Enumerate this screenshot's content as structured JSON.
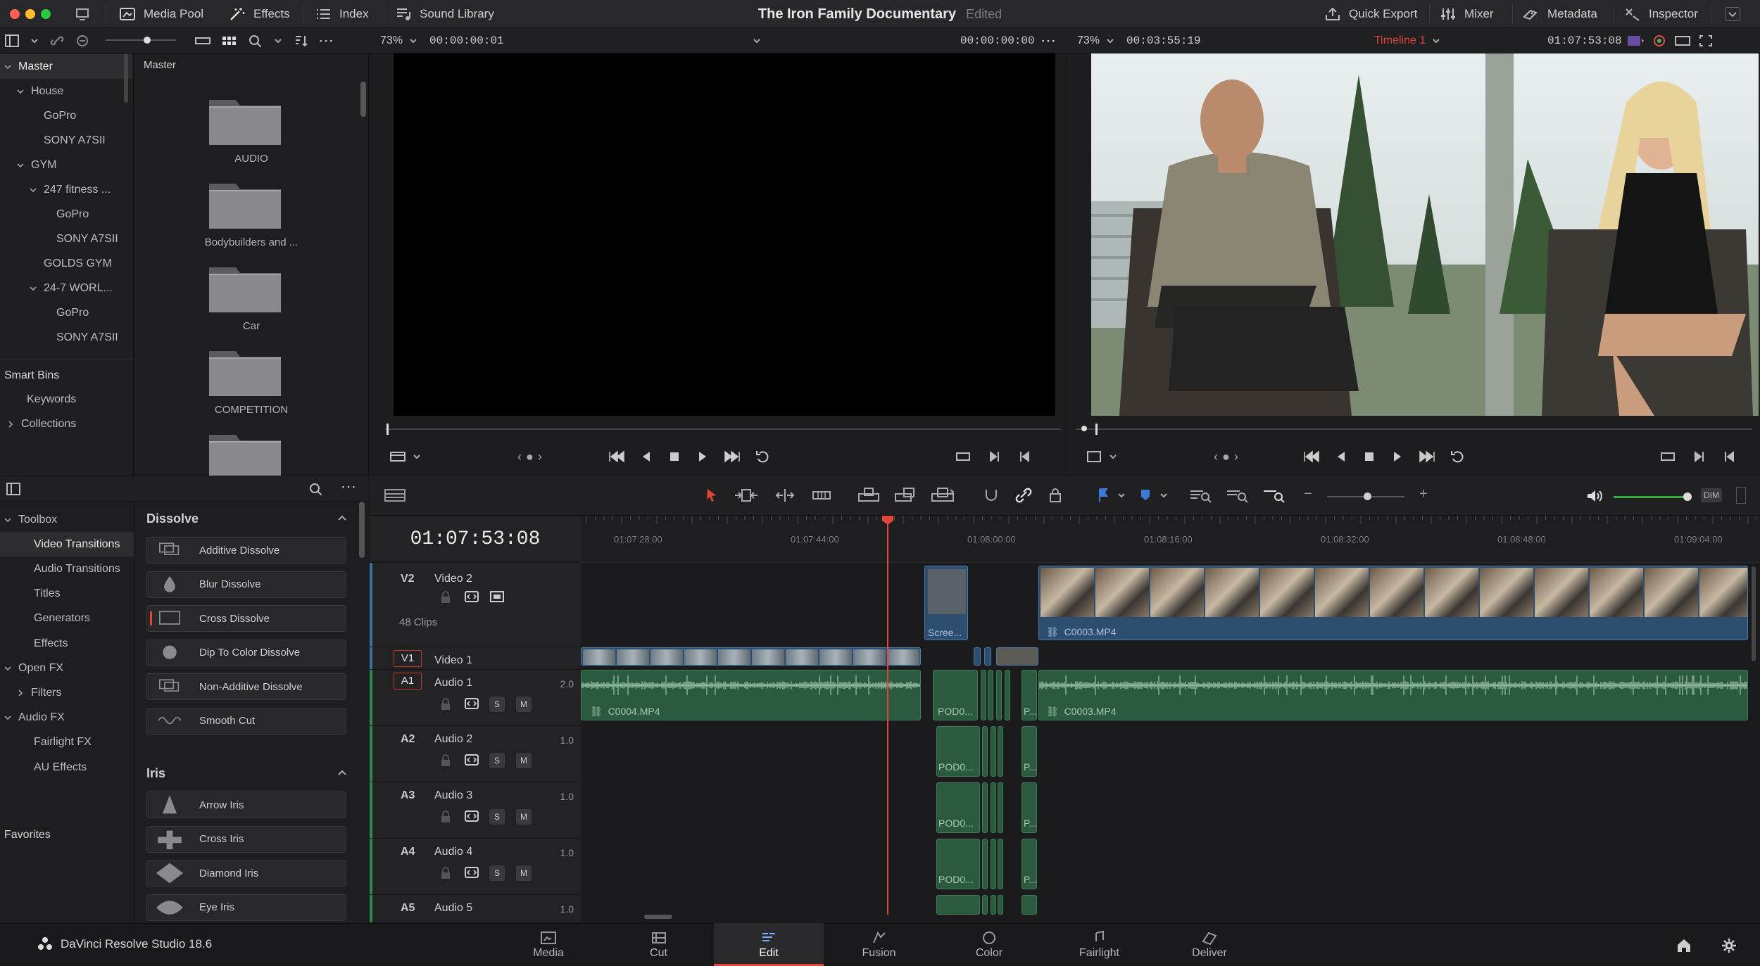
{
  "colors": {
    "accent_red": "#e0443a",
    "audio_green": "#2b5a3f",
    "video_blue": "#2e4e6f",
    "playhead": "#e0443a"
  },
  "topbar": {
    "title": "The Iron Family Documentary",
    "status": "Edited",
    "left": [
      {
        "label": "Media Pool",
        "icon": "media-pool-icon"
      },
      {
        "label": "Effects",
        "icon": "effects-wand-icon"
      },
      {
        "label": "Index",
        "icon": "index-list-icon"
      },
      {
        "label": "Sound Library",
        "icon": "sound-library-icon"
      }
    ],
    "right": [
      {
        "label": "Quick Export",
        "icon": "export-icon"
      },
      {
        "label": "Mixer",
        "icon": "mixer-icon"
      },
      {
        "label": "Metadata",
        "icon": "metadata-icon"
      },
      {
        "label": "Inspector",
        "icon": "inspector-icon"
      }
    ]
  },
  "source_viewer": {
    "zoom": "73%",
    "timecode_left": "00:00:00:01",
    "timecode_right": "00:00:00:00"
  },
  "timeline_viewer": {
    "zoom": "73%",
    "duration": "00:03:55:19",
    "timeline_name": "Timeline 1",
    "timecode": "01:07:53:08"
  },
  "bins": {
    "header": "Master",
    "items": [
      {
        "label": "Master",
        "depth": 0,
        "expand": "open"
      },
      {
        "label": "House",
        "depth": 1,
        "expand": "open"
      },
      {
        "label": "GoPro",
        "depth": 2,
        "expand": ""
      },
      {
        "label": "SONY A7SII",
        "depth": 2,
        "expand": ""
      },
      {
        "label": "GYM",
        "depth": 1,
        "expand": "open"
      },
      {
        "label": "247 fitness ...",
        "depth": 2,
        "expand": "open"
      },
      {
        "label": "GoPro",
        "depth": 3,
        "expand": ""
      },
      {
        "label": "SONY A7SII",
        "depth": 3,
        "expand": ""
      },
      {
        "label": "GOLDS GYM",
        "depth": 2,
        "expand": ""
      },
      {
        "label": "24-7 WORL...",
        "depth": 2,
        "expand": "open"
      },
      {
        "label": "GoPro",
        "depth": 3,
        "expand": ""
      },
      {
        "label": "SONY A7SII",
        "depth": 3,
        "expand": ""
      }
    ],
    "smart_bins": "Smart Bins",
    "smart_items": [
      {
        "label": "Keywords",
        "expand": ""
      },
      {
        "label": "Collections",
        "expand": "closed"
      }
    ]
  },
  "pool": {
    "header": "Master",
    "folders": [
      "AUDIO",
      "Bodybuilders and ...",
      "Car",
      "COMPETITION",
      ""
    ]
  },
  "effects": {
    "sidebar": [
      {
        "label": "Toolbox",
        "depth": 0,
        "expand": "open"
      },
      {
        "label": "Video Transitions",
        "depth": 1,
        "expand": ""
      },
      {
        "label": "Audio Transitions",
        "depth": 1,
        "expand": ""
      },
      {
        "label": "Titles",
        "depth": 1,
        "expand": ""
      },
      {
        "label": "Generators",
        "depth": 1,
        "expand": ""
      },
      {
        "label": "Effects",
        "depth": 1,
        "expand": ""
      },
      {
        "label": "Open FX",
        "depth": 0,
        "expand": "open"
      },
      {
        "label": "Filters",
        "depth": 1,
        "expand": "closed"
      },
      {
        "label": "Audio FX",
        "depth": 0,
        "expand": "open"
      },
      {
        "label": "Fairlight FX",
        "depth": 1,
        "expand": ""
      },
      {
        "label": "AU Effects",
        "depth": 1,
        "expand": ""
      }
    ],
    "favorites": "Favorites",
    "groups": [
      {
        "name": "Dissolve",
        "items": [
          "Additive Dissolve",
          "Blur Dissolve",
          "Cross Dissolve",
          "Dip To Color Dissolve",
          "Non-Additive Dissolve",
          "Smooth Cut"
        ]
      },
      {
        "name": "Iris",
        "items": [
          "Arrow Iris",
          "Cross Iris",
          "Diamond Iris",
          "Eye Iris"
        ]
      }
    ]
  },
  "timeline": {
    "timecode": "01:07:53:08",
    "ruler": [
      "01:07:28:00",
      "01:07:44:00",
      "01:08:00:00",
      "01:08:16:00",
      "01:08:32:00",
      "01:08:48:00",
      "01:09:04:00"
    ],
    "tracks": [
      {
        "id": "V2",
        "name": "Video 2",
        "extra": "48 Clips"
      },
      {
        "id": "V1",
        "name": "Video 1"
      },
      {
        "id": "A1",
        "name": "Audio 1",
        "ch": "2.0"
      },
      {
        "id": "A2",
        "name": "Audio 2",
        "ch": "1.0"
      },
      {
        "id": "A3",
        "name": "Audio 3",
        "ch": "1.0"
      },
      {
        "id": "A4",
        "name": "Audio 4",
        "ch": "1.0"
      },
      {
        "id": "A5",
        "name": "Audio 5",
        "ch": "1.0"
      }
    ],
    "clips": {
      "v2_small": "Scree...",
      "v2_main": "C0003.MP4",
      "a1_left": "C0004.MP4",
      "a1_right": "C0003.MP4",
      "pod": "POD0...",
      "p": "P..."
    },
    "sm": {
      "s": "S",
      "m": "M"
    },
    "dim": "DIM"
  },
  "app": {
    "name": "DaVinci Resolve Studio 18.6"
  },
  "pages": [
    {
      "label": "Media",
      "icon": "media-page-icon"
    },
    {
      "label": "Cut",
      "icon": "cut-page-icon"
    },
    {
      "label": "Edit",
      "icon": "edit-page-icon"
    },
    {
      "label": "Fusion",
      "icon": "fusion-page-icon"
    },
    {
      "label": "Color",
      "icon": "color-page-icon"
    },
    {
      "label": "Fairlight",
      "icon": "fairlight-page-icon"
    },
    {
      "label": "Deliver",
      "icon": "deliver-page-icon"
    }
  ]
}
